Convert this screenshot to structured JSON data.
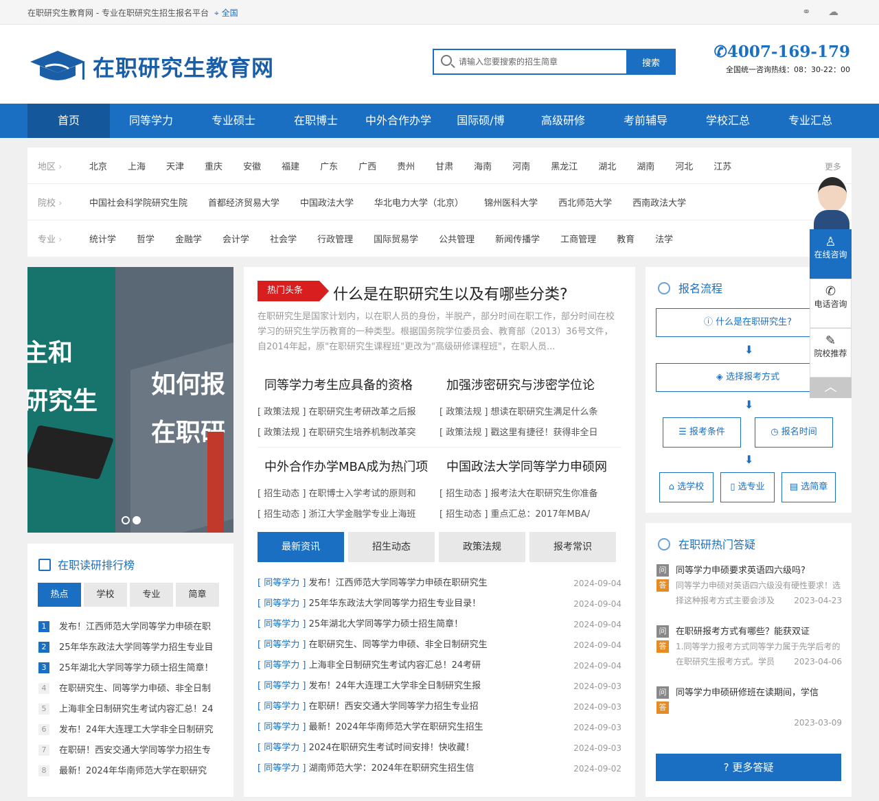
{
  "topbar": {
    "slogan": "在职研究生教育网 - 专业在职研究生招生报名平台",
    "location": "全国",
    "icons": [
      "link-icon",
      "wechat-icon"
    ]
  },
  "header": {
    "logo_text": "在职研究生教育网",
    "search_placeholder": "请输入您要搜索的招生简章",
    "search_button": "搜索",
    "phone": "4007-169-179",
    "hotline": "全国统一咨询热线：08：30-22：00"
  },
  "nav": {
    "items": [
      "首页",
      "同等学力",
      "专业硕士",
      "在职博士",
      "中外合作办学",
      "国际硕/博",
      "高级研修",
      "考前辅导",
      "学校汇总",
      "专业汇总"
    ]
  },
  "filters": {
    "region": {
      "label": "地区",
      "items": [
        "北京",
        "上海",
        "天津",
        "重庆",
        "安徽",
        "福建",
        "广东",
        "广西",
        "贵州",
        "甘肃",
        "海南",
        "河南",
        "黑龙江",
        "湖北",
        "湖南",
        "河北",
        "江苏"
      ],
      "more": "更多"
    },
    "school": {
      "label": "院校",
      "items": [
        "中国社会科学院研究生院",
        "首都经济贸易大学",
        "中国政法大学",
        "华北电力大学（北京）",
        "锦州医科大学",
        "西北师范大学",
        "西南政法大学"
      ]
    },
    "major": {
      "label": "专业",
      "items": [
        "统计学",
        "哲学",
        "金融学",
        "会计学",
        "社会学",
        "行政管理",
        "国际贸易学",
        "公共管理",
        "新闻传播学",
        "工商管理",
        "教育",
        "法学"
      ]
    }
  },
  "banner": {
    "text_left_1": "主和",
    "text_left_2": "研究生",
    "text_right_1": "如何报",
    "text_right_2": "在职研"
  },
  "headline": {
    "tag": "热门头条",
    "title": "什么是在职研究生以及有哪些分类?",
    "desc": "在职研究生是国家计划内，以在职人员的身份，半脱产，部分时间在职工作，部分时间在校学习的研究生学历教育的一种类型。根据国务院学位委员会、教育部（2013）36号文件，自2014年起，原\"在职研究生课程班\"更改为\"高级研修课程班\"，在职人员..."
  },
  "articles": [
    {
      "title": "同等学力考生应具备的资格",
      "lines": [
        "[ 政策法规 ] 在职研究生考研改革之后报",
        "[ 政策法规 ] 在职研究生培养机制改革突"
      ]
    },
    {
      "title": "加强涉密研究与涉密学位论",
      "lines": [
        "[ 政策法规 ] 想读在职研究生满足什么条",
        "[ 政策法规 ] 戳这里有捷径！获得非全日"
      ]
    },
    {
      "title": "中外合作办学MBA成为热门项",
      "lines": [
        "[ 招生动态 ] 在职博士入学考试的原则和",
        "[ 招生动态 ] 浙江大学金融学专业上海班"
      ]
    },
    {
      "title": "中国政法大学同等学力申硕网",
      "lines": [
        "[ 招生动态 ] 报考法大在职研究生你准备",
        "[ 招生动态 ] 重点汇总：2017年MBA/"
      ]
    }
  ],
  "news_tabs": [
    "最新资讯",
    "招生动态",
    "政策法规",
    "报考常识"
  ],
  "news": [
    {
      "cat": "[ 同等学力 ]",
      "title": "发布！江西师范大学同等学力申硕在职研究生",
      "date": "2024-09-04"
    },
    {
      "cat": "[ 同等学力 ]",
      "title": "25年华东政法大学同等学力招生专业目录！",
      "date": "2024-09-04"
    },
    {
      "cat": "[ 同等学力 ]",
      "title": "25年湖北大学同等学力硕士招生简章！",
      "date": "2024-09-04"
    },
    {
      "cat": "[ 同等学力 ]",
      "title": "在职研究生、同等学力申硕、非全日制研究生",
      "date": "2024-09-04"
    },
    {
      "cat": "[ 同等学力 ]",
      "title": "上海非全日制研究生考试内容汇总！24考研",
      "date": "2024-09-04"
    },
    {
      "cat": "[ 同等学力 ]",
      "title": "发布！24年大连理工大学非全日制研究生报",
      "date": "2024-09-03"
    },
    {
      "cat": "[ 同等学力 ]",
      "title": "在职研！西安交通大学同等学力招生专业招",
      "date": "2024-09-03"
    },
    {
      "cat": "[ 同等学力 ]",
      "title": "最新！2024年华南师范大学在职研究生招生",
      "date": "2024-09-03"
    },
    {
      "cat": "[ 同等学力 ]",
      "title": "2024在职研究生考试时间安排！快收藏！",
      "date": "2024-09-03"
    },
    {
      "cat": "[ 同等学力 ]",
      "title": "湖南师范大学：2024年在职研究生招生信",
      "date": "2024-09-02"
    }
  ],
  "rank": {
    "title": "在职读研排行榜",
    "tabs": [
      "热点",
      "学校",
      "专业",
      "简章"
    ],
    "items": [
      {
        "n": "1",
        "t": "发布！江西师范大学同等学力申硕在职"
      },
      {
        "n": "2",
        "t": "25年华东政法大学同等学力招生专业目"
      },
      {
        "n": "3",
        "t": "25年湖北大学同等学力硕士招生简章！"
      },
      {
        "n": "4",
        "t": "在职研究生、同等学力申硕、非全日制"
      },
      {
        "n": "5",
        "t": "上海非全日制研究生考试内容汇总！24"
      },
      {
        "n": "6",
        "t": "发布！24年大连理工大学非全日制研究"
      },
      {
        "n": "7",
        "t": "在职研！西安交通大学同等学力招生专"
      },
      {
        "n": "8",
        "t": "最新！2024年华南师范大学在职研究"
      }
    ]
  },
  "process": {
    "title": "报名流程",
    "what": "什么是在职研究生?",
    "method": "选择报考方式",
    "cond": "报考条件",
    "time": "报名时间",
    "school": "选学校",
    "major": "选专业",
    "brochure": "选简章"
  },
  "qa": {
    "title": "在职研热门答疑",
    "q_badge": "问",
    "a_badge": "答",
    "items": [
      {
        "q": "同等学力申硕要求英语四六级吗?",
        "a": "同等学力申硕对英语四六级没有硬性要求！选择这种报考方式主要会涉及",
        "date": "2023-04-23"
      },
      {
        "q": "在职研报考方式有哪些？能获双证",
        "a": "1.同等学力报考方式同等学力属于先学后考的在职研究生报考方式。学员",
        "date": "2023-04-06"
      },
      {
        "q": "同等学力申硕研修班在读期间，学信",
        "a": "",
        "date": "2023-03-09"
      }
    ],
    "more": "? 更多答疑"
  },
  "side": {
    "online": "在线咨询",
    "tel": "电话咨询",
    "recommend": "院校推荐"
  }
}
